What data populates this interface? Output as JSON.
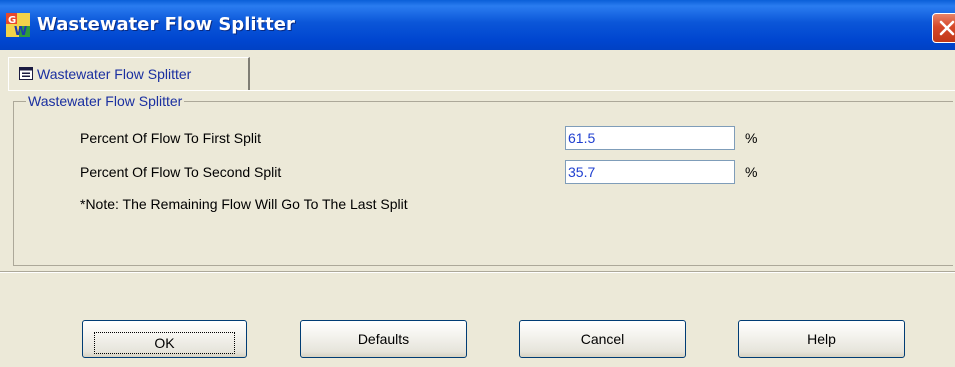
{
  "window": {
    "title": "Wastewater Flow Splitter",
    "accent_color": "#0a5fd8",
    "close_icon": "close-icon",
    "app_icon": "gw-app-icon"
  },
  "tabs": [
    {
      "label": "Wastewater Flow Splitter",
      "icon": "form-icon",
      "selected": true
    }
  ],
  "group": {
    "legend": "Wastewater Flow Splitter",
    "fields": [
      {
        "label": "Percent Of Flow To First Split",
        "value": "61.5",
        "unit": "%"
      },
      {
        "label": "Percent Of Flow To Second Split",
        "value": "35.7",
        "unit": "%"
      }
    ],
    "note": "*Note: The Remaining Flow Will Go To The Last Split"
  },
  "buttons": {
    "ok": "OK",
    "defaults": "Defaults",
    "cancel": "Cancel",
    "help": "Help"
  }
}
